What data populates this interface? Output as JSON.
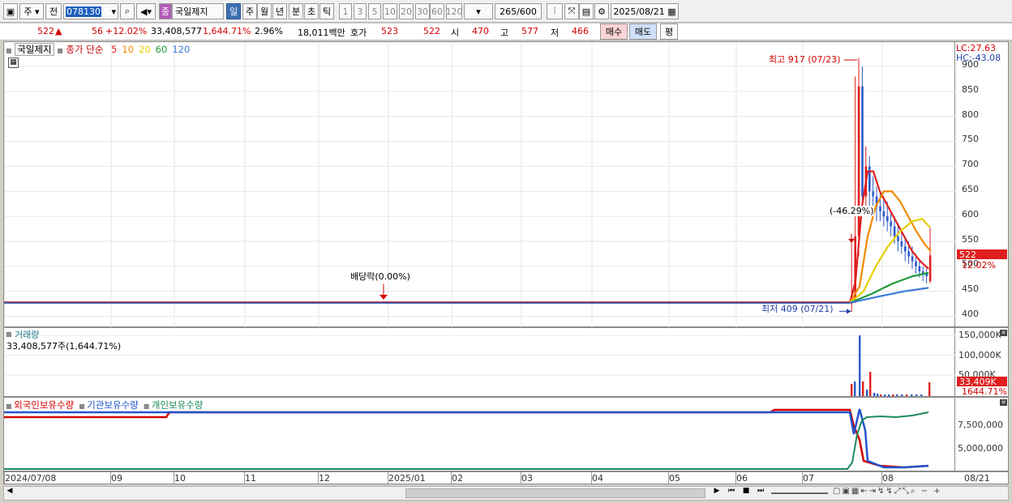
{
  "toolbar": {
    "period": "주",
    "prev": "전",
    "code": "078130",
    "type_badge": "종",
    "name": "국일제지",
    "periods": [
      "일",
      "주",
      "월",
      "년",
      "분",
      "초",
      "틱"
    ],
    "intervals": [
      "1",
      "3",
      "5",
      "10",
      "20",
      "30",
      "60",
      "120"
    ],
    "count": "265",
    "count_total": "/600",
    "date": "2025/08/21"
  },
  "quote": {
    "price": "522",
    "up_icon": "▲",
    "change": "56",
    "change_pct": "+12.02%",
    "volume": "33,408,577",
    "volume_pct": "1,644.71%",
    "turnover": "2.96%",
    "amount": "18,011백만",
    "ask_label": "호가",
    "ask": "523",
    "bid": "522",
    "open_label": "시",
    "open": "470",
    "high_label": "고",
    "high": "577",
    "low_label": "저",
    "low": "466",
    "buy": "매수",
    "sell": "매도",
    "eval": "평"
  },
  "price_panel": {
    "title": "국일제지",
    "legend_prefix": "종가 단순",
    "ma": [
      {
        "label": "5",
        "color": "#e01e1e"
      },
      {
        "label": "10",
        "color": "#f08a00"
      },
      {
        "label": "20",
        "color": "#e6d000"
      },
      {
        "label": "60",
        "color": "#1e9a3a"
      },
      {
        "label": "120",
        "color": "#3a7bd5"
      }
    ],
    "lc": "LC:27.63",
    "hc": "HC:-43.08",
    "y_ticks": [
      "900",
      "850",
      "800",
      "750",
      "700",
      "650",
      "600",
      "550",
      "500",
      "450",
      "400"
    ],
    "last_price": "522",
    "last_pct": "12.02%",
    "high_note": "최고 917 (07/23)",
    "low_note": "최저 409 (07/21)",
    "dividend_note": "배당락(0.00%)",
    "drop_note": "(-46.29%)"
  },
  "volume_panel": {
    "title": "거래량",
    "sub": "33,408,577주(1,644.71%)",
    "y_ticks": [
      "150,000K",
      "100,000K",
      "50,000K"
    ],
    "last_vol": "33,409K",
    "last_pct": "1644.71%"
  },
  "holding_panel": {
    "legend": [
      {
        "label": "외국인보유수량",
        "color": "#d40000"
      },
      {
        "label": "기관보유수량",
        "color": "#2255cc"
      },
      {
        "label": "개인보유수량",
        "color": "#1e8a5a"
      }
    ],
    "y_ticks": [
      "7,500,000",
      "5,000,000"
    ]
  },
  "x_axis": {
    "labels": [
      "2024/07/08",
      "09",
      "10",
      "11",
      "12",
      "2025/01",
      "02",
      "03",
      "04",
      "05",
      "06",
      "07",
      "08"
    ],
    "last": "08/21"
  },
  "colors": {
    "up": "#e01e1e",
    "down": "#2c5ac8",
    "base": "#3a4fa8"
  }
}
